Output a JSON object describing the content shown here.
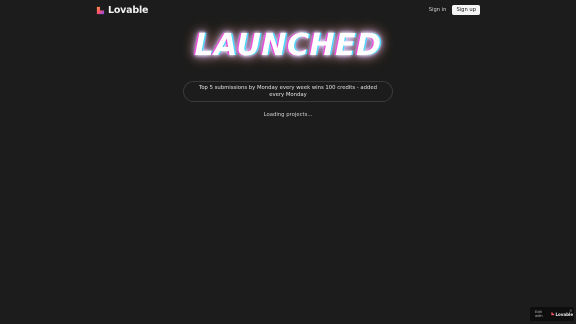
{
  "header": {
    "logo_text": "Lovable",
    "sign_in_label": "Sign in",
    "sign_up_label": "Sign up"
  },
  "hero": {
    "title": "LAUNCHED"
  },
  "info": {
    "text": "Top 5 submissions by Monday every week wins 100 credits - added every Monday"
  },
  "status": {
    "loading_text": "Loading projects..."
  },
  "badge": {
    "edit_text": "Edit with",
    "logo_text": "Lovable",
    "close_label": "×"
  },
  "colors": {
    "background": "#1c1c1c",
    "button_bg": "#f5f5f5",
    "brand_gradient_start": "#ff4f6d",
    "brand_gradient_end": "#ff9a3c"
  }
}
